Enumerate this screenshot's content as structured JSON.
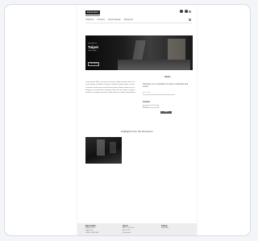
{
  "header": {
    "logo_text": "Edvers&Co",
    "icons": [
      "facebook-icon",
      "instagram-icon",
      "language-icon"
    ],
    "nav": [
      "Collection",
      "Furniture",
      "Interior Design",
      "Showroom"
    ]
  },
  "hero": {
    "caption_top": "Showroom",
    "caption_big": "Taipei",
    "caption_sub": "Now Open",
    "button": "View more"
  },
  "body": {
    "paragraph": "Lorem ipsum dolor sit amet consectetur adipiscing elit sed do eiusmod tempor incididunt ut labore et dolore magna aliqua ut enim ad minim veniam quis nostrud exercitation ullamco laboris nisi ut aliquip ex ea commodo consequat duis aute irure dolor in reprehenderit in voluptate velit esse cillum dolore eu fugiat nulla pariatur"
  },
  "sidebar": {
    "title": "News",
    "text": "Subscribe to our newsletter for news on collections and events",
    "email_placeholder": "your email",
    "subheading": "Contact",
    "name_placeholder": "name",
    "button": "Send"
  },
  "section": {
    "title": "Highlights from the showroom"
  },
  "footer": {
    "col1": {
      "heading": "Edvers&Co",
      "lines": [
        "Address Line",
        "Taipei City",
        "+886 2 0000 0000"
      ]
    },
    "col2": {
      "heading": "Hours",
      "lines": [
        "Mon – Fri 10–19",
        "Sat 11–18",
        "Sun closed"
      ]
    },
    "col3": {
      "heading": "Follow",
      "lines": [
        "Newsletter"
      ]
    }
  }
}
